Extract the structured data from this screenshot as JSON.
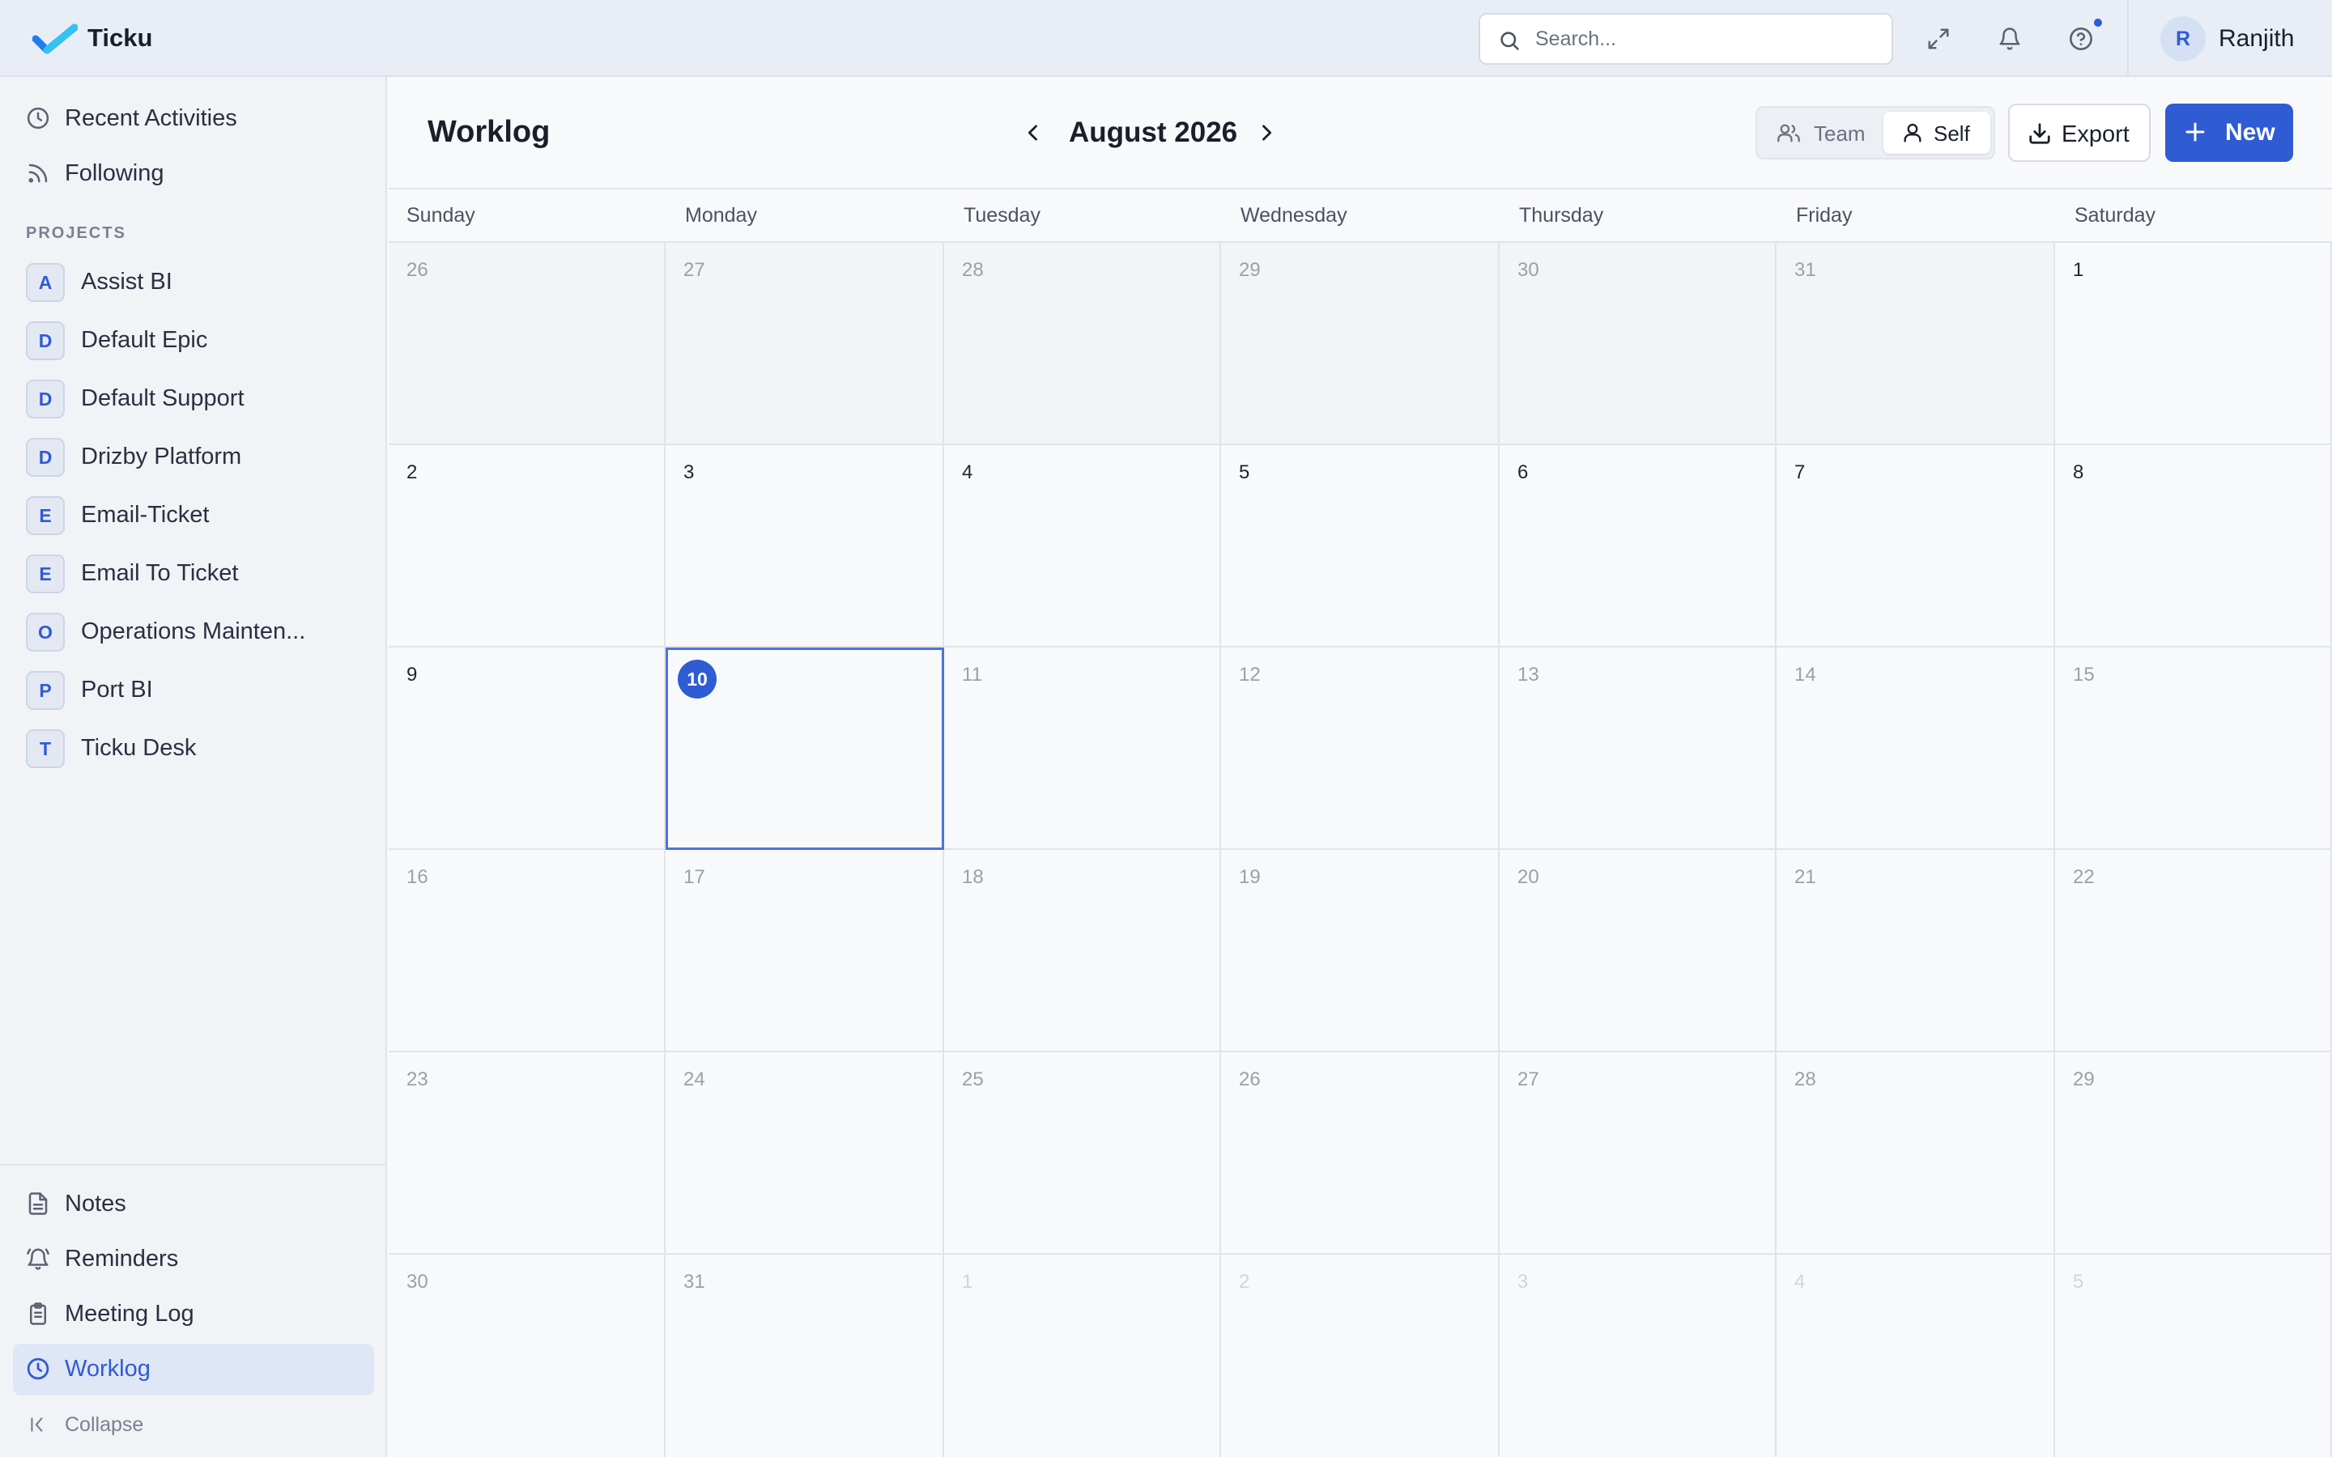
{
  "app": {
    "name": "Ticku"
  },
  "topbar": {
    "search_placeholder": "Search...",
    "user": {
      "initial": "R",
      "name": "Ranjith"
    },
    "icons": [
      "expand-icon",
      "bell-icon",
      "help-icon"
    ]
  },
  "sidebar": {
    "top_links": [
      {
        "label": "Recent Activities",
        "icon": "clock-icon"
      },
      {
        "label": "Following",
        "icon": "rss-icon"
      }
    ],
    "projects_heading": "PROJECTS",
    "projects": [
      {
        "initial": "A",
        "label": "Assist BI"
      },
      {
        "initial": "D",
        "label": "Default Epic"
      },
      {
        "initial": "D",
        "label": "Default Support"
      },
      {
        "initial": "D",
        "label": "Drizby Platform"
      },
      {
        "initial": "E",
        "label": "Email-Ticket"
      },
      {
        "initial": "E",
        "label": "Email To Ticket"
      },
      {
        "initial": "O",
        "label": "Operations Mainten..."
      },
      {
        "initial": "P",
        "label": "Port BI"
      },
      {
        "initial": "T",
        "label": "Ticku Desk"
      }
    ],
    "bottom_links": [
      {
        "label": "Notes",
        "icon": "file-text-icon"
      },
      {
        "label": "Reminders",
        "icon": "bell-ring-icon"
      },
      {
        "label": "Meeting Log",
        "icon": "clipboard-icon"
      },
      {
        "label": "Worklog",
        "icon": "clock-icon",
        "active": true
      }
    ],
    "collapse_label": "Collapse"
  },
  "main": {
    "title": "Worklog",
    "month_label": "August 2026",
    "toggle": {
      "team": "Team",
      "self": "Self",
      "selected": "self"
    },
    "export_label": "Export",
    "new_label": "New"
  },
  "calendar": {
    "weekdays": [
      "Sunday",
      "Monday",
      "Tuesday",
      "Wednesday",
      "Thursday",
      "Friday",
      "Saturday"
    ],
    "today": 10,
    "weeks": [
      [
        {
          "d": "26",
          "s": "prev"
        },
        {
          "d": "27",
          "s": "prev"
        },
        {
          "d": "28",
          "s": "prev"
        },
        {
          "d": "29",
          "s": "prev"
        },
        {
          "d": "30",
          "s": "prev"
        },
        {
          "d": "31",
          "s": "prev"
        },
        {
          "d": "1",
          "s": "cur"
        }
      ],
      [
        {
          "d": "2",
          "s": "cur"
        },
        {
          "d": "3",
          "s": "cur"
        },
        {
          "d": "4",
          "s": "cur"
        },
        {
          "d": "5",
          "s": "cur"
        },
        {
          "d": "6",
          "s": "cur"
        },
        {
          "d": "7",
          "s": "cur"
        },
        {
          "d": "8",
          "s": "cur"
        }
      ],
      [
        {
          "d": "9",
          "s": "cur"
        },
        {
          "d": "10",
          "s": "today"
        },
        {
          "d": "11",
          "s": "later"
        },
        {
          "d": "12",
          "s": "later"
        },
        {
          "d": "13",
          "s": "later"
        },
        {
          "d": "14",
          "s": "later"
        },
        {
          "d": "15",
          "s": "later"
        }
      ],
      [
        {
          "d": "16",
          "s": "later"
        },
        {
          "d": "17",
          "s": "later"
        },
        {
          "d": "18",
          "s": "later"
        },
        {
          "d": "19",
          "s": "later"
        },
        {
          "d": "20",
          "s": "later"
        },
        {
          "d": "21",
          "s": "later"
        },
        {
          "d": "22",
          "s": "later"
        }
      ],
      [
        {
          "d": "23",
          "s": "later"
        },
        {
          "d": "24",
          "s": "later"
        },
        {
          "d": "25",
          "s": "later"
        },
        {
          "d": "26",
          "s": "later"
        },
        {
          "d": "27",
          "s": "later"
        },
        {
          "d": "28",
          "s": "later"
        },
        {
          "d": "29",
          "s": "later"
        }
      ],
      [
        {
          "d": "30",
          "s": "later"
        },
        {
          "d": "31",
          "s": "later"
        },
        {
          "d": "1",
          "s": "next"
        },
        {
          "d": "2",
          "s": "next"
        },
        {
          "d": "3",
          "s": "next"
        },
        {
          "d": "4",
          "s": "next"
        },
        {
          "d": "5",
          "s": "next"
        }
      ]
    ]
  },
  "colors": {
    "accent": "#2f5bd3",
    "topbar_bg": "#e9eef6",
    "sidebar_bg": "#f1f3f7",
    "active_item_bg": "#dfe6f5"
  }
}
